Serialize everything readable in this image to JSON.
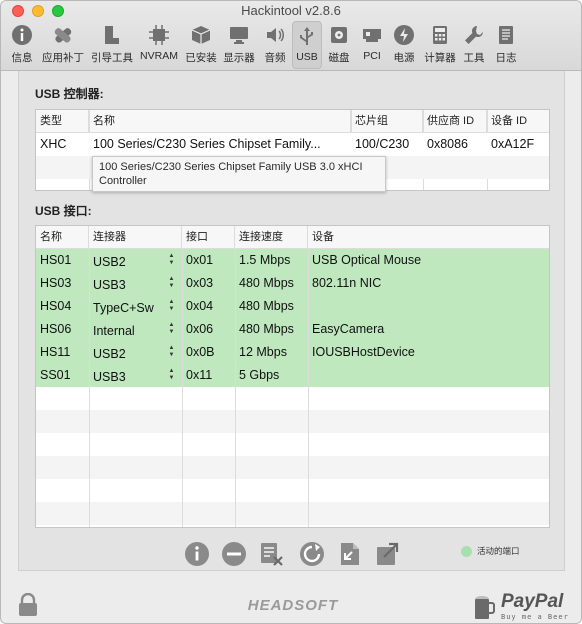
{
  "window": {
    "title": "Hackintool v2.8.6"
  },
  "toolbar": {
    "items": [
      {
        "label": "信息",
        "icon": "info-icon"
      },
      {
        "label": "应用补丁",
        "icon": "patch-icon"
      },
      {
        "label": "引导工具",
        "icon": "boot-icon"
      },
      {
        "label": "NVRAM",
        "icon": "chip-icon"
      },
      {
        "label": "已安装",
        "icon": "installed-box-icon"
      },
      {
        "label": "显示器",
        "icon": "display-icon"
      },
      {
        "label": "音频",
        "icon": "speaker-icon"
      },
      {
        "label": "USB",
        "icon": "usb-icon",
        "active": true
      },
      {
        "label": "磁盘",
        "icon": "disk-icon"
      },
      {
        "label": "PCI",
        "icon": "pci-card-icon"
      },
      {
        "label": "电源",
        "icon": "power-icon"
      },
      {
        "label": "计算器",
        "icon": "calculator-icon"
      },
      {
        "label": "工具",
        "icon": "wrench-icon"
      },
      {
        "label": "日志",
        "icon": "log-icon"
      }
    ]
  },
  "controllers": {
    "section_title": "USB 控制器:",
    "columns": [
      "类型",
      "名称",
      "芯片组",
      "供应商 ID",
      "设备 ID"
    ],
    "rows": [
      {
        "type": "XHC",
        "name": "100 Series/C230 Series Chipset Family...",
        "chipset": "100/C230",
        "vendor_id": "0x8086",
        "device_id": "0xA12F"
      }
    ],
    "tooltip": "100 Series/C230 Series Chipset Family USB 3.0 xHCI Controller"
  },
  "ports": {
    "section_title": "USB 接口:",
    "columns": [
      "名称",
      "连接器",
      "接口",
      "连接速度",
      "设备"
    ],
    "rows": [
      {
        "name": "HS01",
        "connector": "USB2",
        "port": "0x01",
        "speed": "1.5 Mbps",
        "device": "USB Optical Mouse"
      },
      {
        "name": "HS03",
        "connector": "USB3",
        "port": "0x03",
        "speed": "480 Mbps",
        "device": "802.11n NIC"
      },
      {
        "name": "HS04",
        "connector": "TypeC+Sw",
        "port": "0x04",
        "speed": "480 Mbps",
        "device": ""
      },
      {
        "name": "HS06",
        "connector": "Internal",
        "port": "0x06",
        "speed": "480 Mbps",
        "device": "EasyCamera"
      },
      {
        "name": "HS11",
        "connector": "USB2",
        "port": "0x0B",
        "speed": "12 Mbps",
        "device": "IOUSBHostDevice"
      },
      {
        "name": "SS01",
        "connector": "USB3",
        "port": "0x11",
        "speed": "5 Gbps",
        "device": ""
      }
    ],
    "active_row_color": "#bfe8bf"
  },
  "bottom_toolbar": {
    "buttons": [
      "info-icon",
      "remove-icon",
      "clear-icon",
      "refresh-icon",
      "import-icon",
      "export-icon"
    ]
  },
  "legend": {
    "label": "活动的端口",
    "color": "#a8dfae"
  },
  "footer": {
    "brand": "HEADSOFT",
    "paypal": "PayPal",
    "paypal_sub": "Buy me a Beer"
  }
}
